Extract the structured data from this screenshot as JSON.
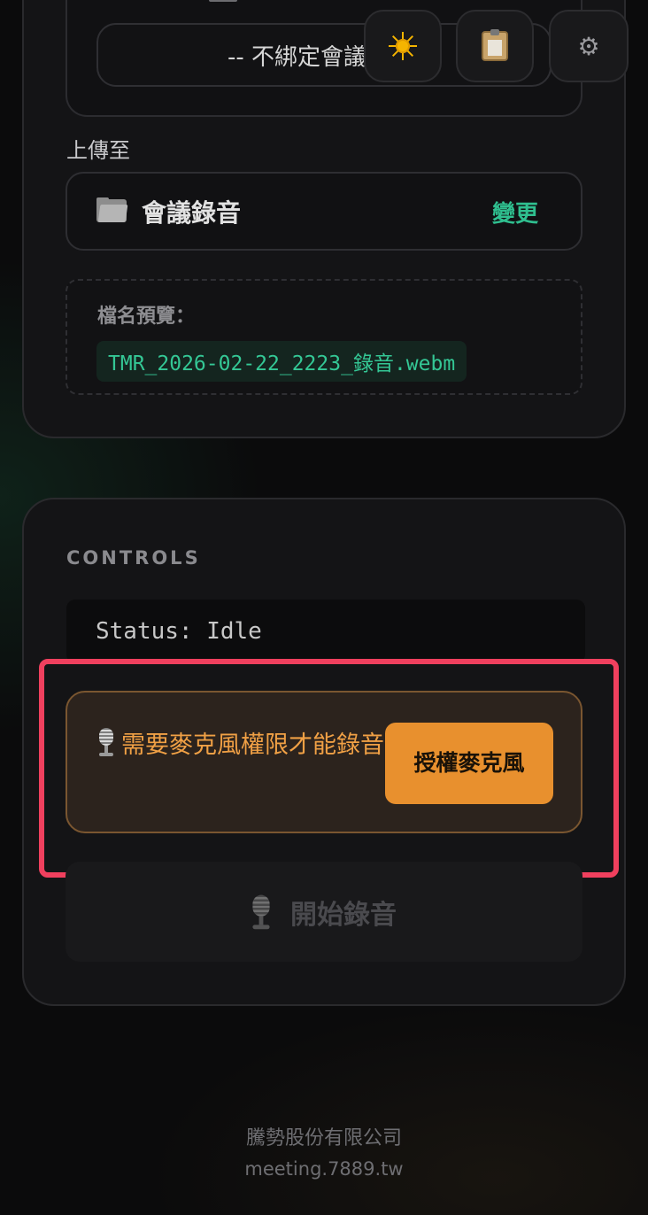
{
  "session": {
    "select_value": "-- 不綁定會議"
  },
  "toolbar": {
    "theme_icon": "sun-icon",
    "history_icon": "clipboard-icon",
    "settings_icon": "gear-icon",
    "settings_glyph": "⚙"
  },
  "upload": {
    "label": "上傳至",
    "folder_icon": "folder-icon",
    "folder_name": "會議錄音",
    "change_label": "變更"
  },
  "filename_preview": {
    "label": "檔名預覽：",
    "value": "TMR_2026-02-22_2223_錄音.webm"
  },
  "controls": {
    "title": "CONTROLS",
    "status": "Status: Idle",
    "permission_banner": {
      "message": "需要麥克風權限才能錄音",
      "button_label": "授權麥克風"
    },
    "record_button_label": "開始錄音"
  },
  "footer": {
    "company": "騰勢股份有限公司",
    "domain": "meeting.7889.tw"
  },
  "colors": {
    "accent_green": "#2fbf8f",
    "warning_orange": "#e8902e",
    "highlight_red": "#f0405e"
  }
}
